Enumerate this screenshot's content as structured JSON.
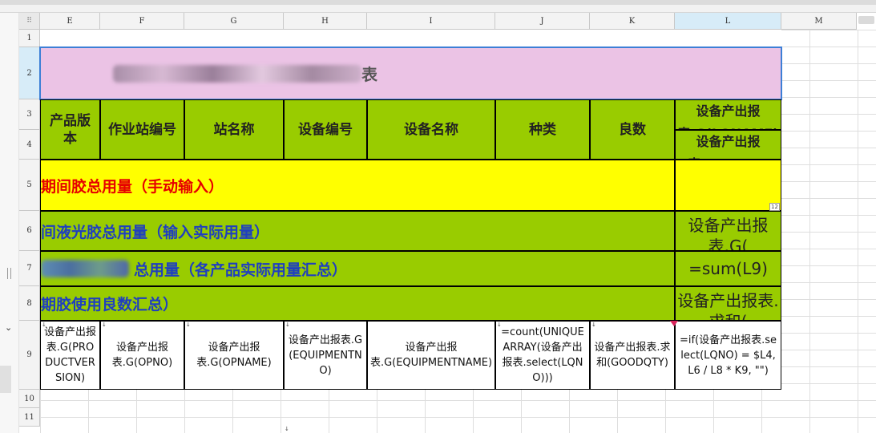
{
  "columns": [
    "E",
    "F",
    "G",
    "H",
    "I",
    "J",
    "K",
    "L",
    "M"
  ],
  "rows": [
    "1",
    "2",
    "3",
    "4",
    "5",
    "6",
    "7",
    "8",
    "9",
    "10",
    "11"
  ],
  "sheet": {
    "row2_title": "表",
    "row3_headers": {
      "E": "产品版本",
      "F": "作业站编号",
      "G": "站名称",
      "H": "设备编号",
      "I": "设备名称",
      "J": "种类",
      "K": "良数",
      "L3": "设备产出报表.G(LQNAME)",
      "L4": "设备产出报表.G(LQNO)"
    },
    "row5_text": "期间胶总用量（手动输入）",
    "row6_text": "间液光胶总用量（输入实际用量）",
    "row7_text": "总用量（各产品实际用量汇总）",
    "row8_text": "期胶使用良数汇总）",
    "L6": "设备产出报表.G(",
    "L7": "=sum(L9)",
    "L8": "设备产出报表.求和(",
    "row9": {
      "E": "设备产出报表.G(PRODUCTVERSION)",
      "F": "设备产出报表.G(OPNO)",
      "G": "设备产出报表.G(OPNAME)",
      "H": "设备产出报表.G(EQUIPMENTNO)",
      "I": "设备产出报表.G(EQUIPMENTNAME)",
      "J": "=count(UNIQUEARRAY(设备产出报表.select(LQNO)))",
      "K": "设备产出报表.求和(GOODQTY)",
      "L": "=if(设备产出报表.select(LQNO) = $L4, L6 / L8 * K9, \"\")"
    },
    "corner_marker": "12",
    "selection_color": "#3c7fd6",
    "fill_colors": {
      "pink": "#ebc3e5",
      "green": "#99cc00",
      "yellow": "#ffff00"
    }
  }
}
